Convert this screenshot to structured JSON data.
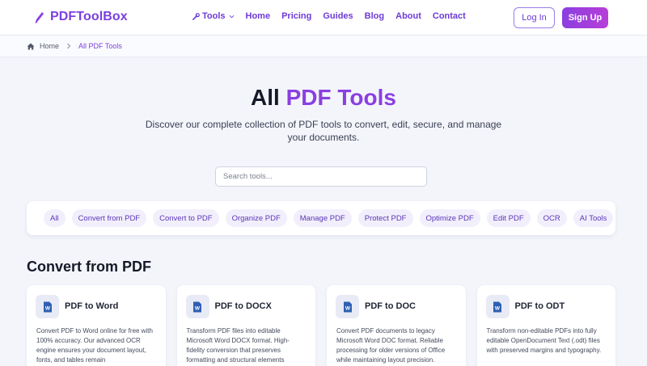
{
  "header": {
    "logo_text": "PDFToolBox",
    "nav": [
      {
        "label": "Tools"
      },
      {
        "label": "Home"
      },
      {
        "label": "Pricing"
      },
      {
        "label": "Guides"
      },
      {
        "label": "Blog"
      },
      {
        "label": "About"
      },
      {
        "label": "Contact"
      }
    ],
    "login_label": "Log In",
    "signup_label": "Sign Up"
  },
  "breadcrumb": {
    "home": "Home",
    "current": "All PDF Tools"
  },
  "hero": {
    "title_plain": "All",
    "title_accent": "PDF Tools",
    "subtitle": "Discover our complete collection of PDF tools to convert, edit, secure, and manage your documents."
  },
  "search": {
    "placeholder": "Search tools..."
  },
  "filters": [
    "All",
    "Convert from PDF",
    "Convert to PDF",
    "Organize PDF",
    "Manage PDF",
    "Protect PDF",
    "Optimize PDF",
    "Edit PDF",
    "OCR",
    "AI Tools"
  ],
  "section": {
    "title": "Convert from PDF"
  },
  "cards": [
    {
      "title": "PDF to Word",
      "desc": "Convert PDF to Word online for free with 100% accuracy. Our advanced OCR engine ensures your document layout, fonts, and tables remain",
      "icon": "word-doc-icon"
    },
    {
      "title": "PDF to DOCX",
      "desc": "Transform PDF files into editable Microsoft Word DOCX format. High-fidelity conversion that preserves formatting and structural elements",
      "icon": "word-doc-icon"
    },
    {
      "title": "PDF to DOC",
      "desc": "Convert PDF documents to legacy Microsoft Word DOC format. Reliable processing for older versions of Office while maintaining layout precision.",
      "icon": "word-doc-icon"
    },
    {
      "title": "PDF to ODT",
      "desc": "Transform non-editable PDFs into fully editable OpenDocument Text (.odt) files with preserved margins and typography.",
      "icon": "word-doc-icon"
    }
  ],
  "colors": {
    "brand": "#8b3fe0",
    "nav": "#6d3bd6",
    "chip_bg": "#f2effc",
    "page_bg": "#f3f5fb"
  }
}
